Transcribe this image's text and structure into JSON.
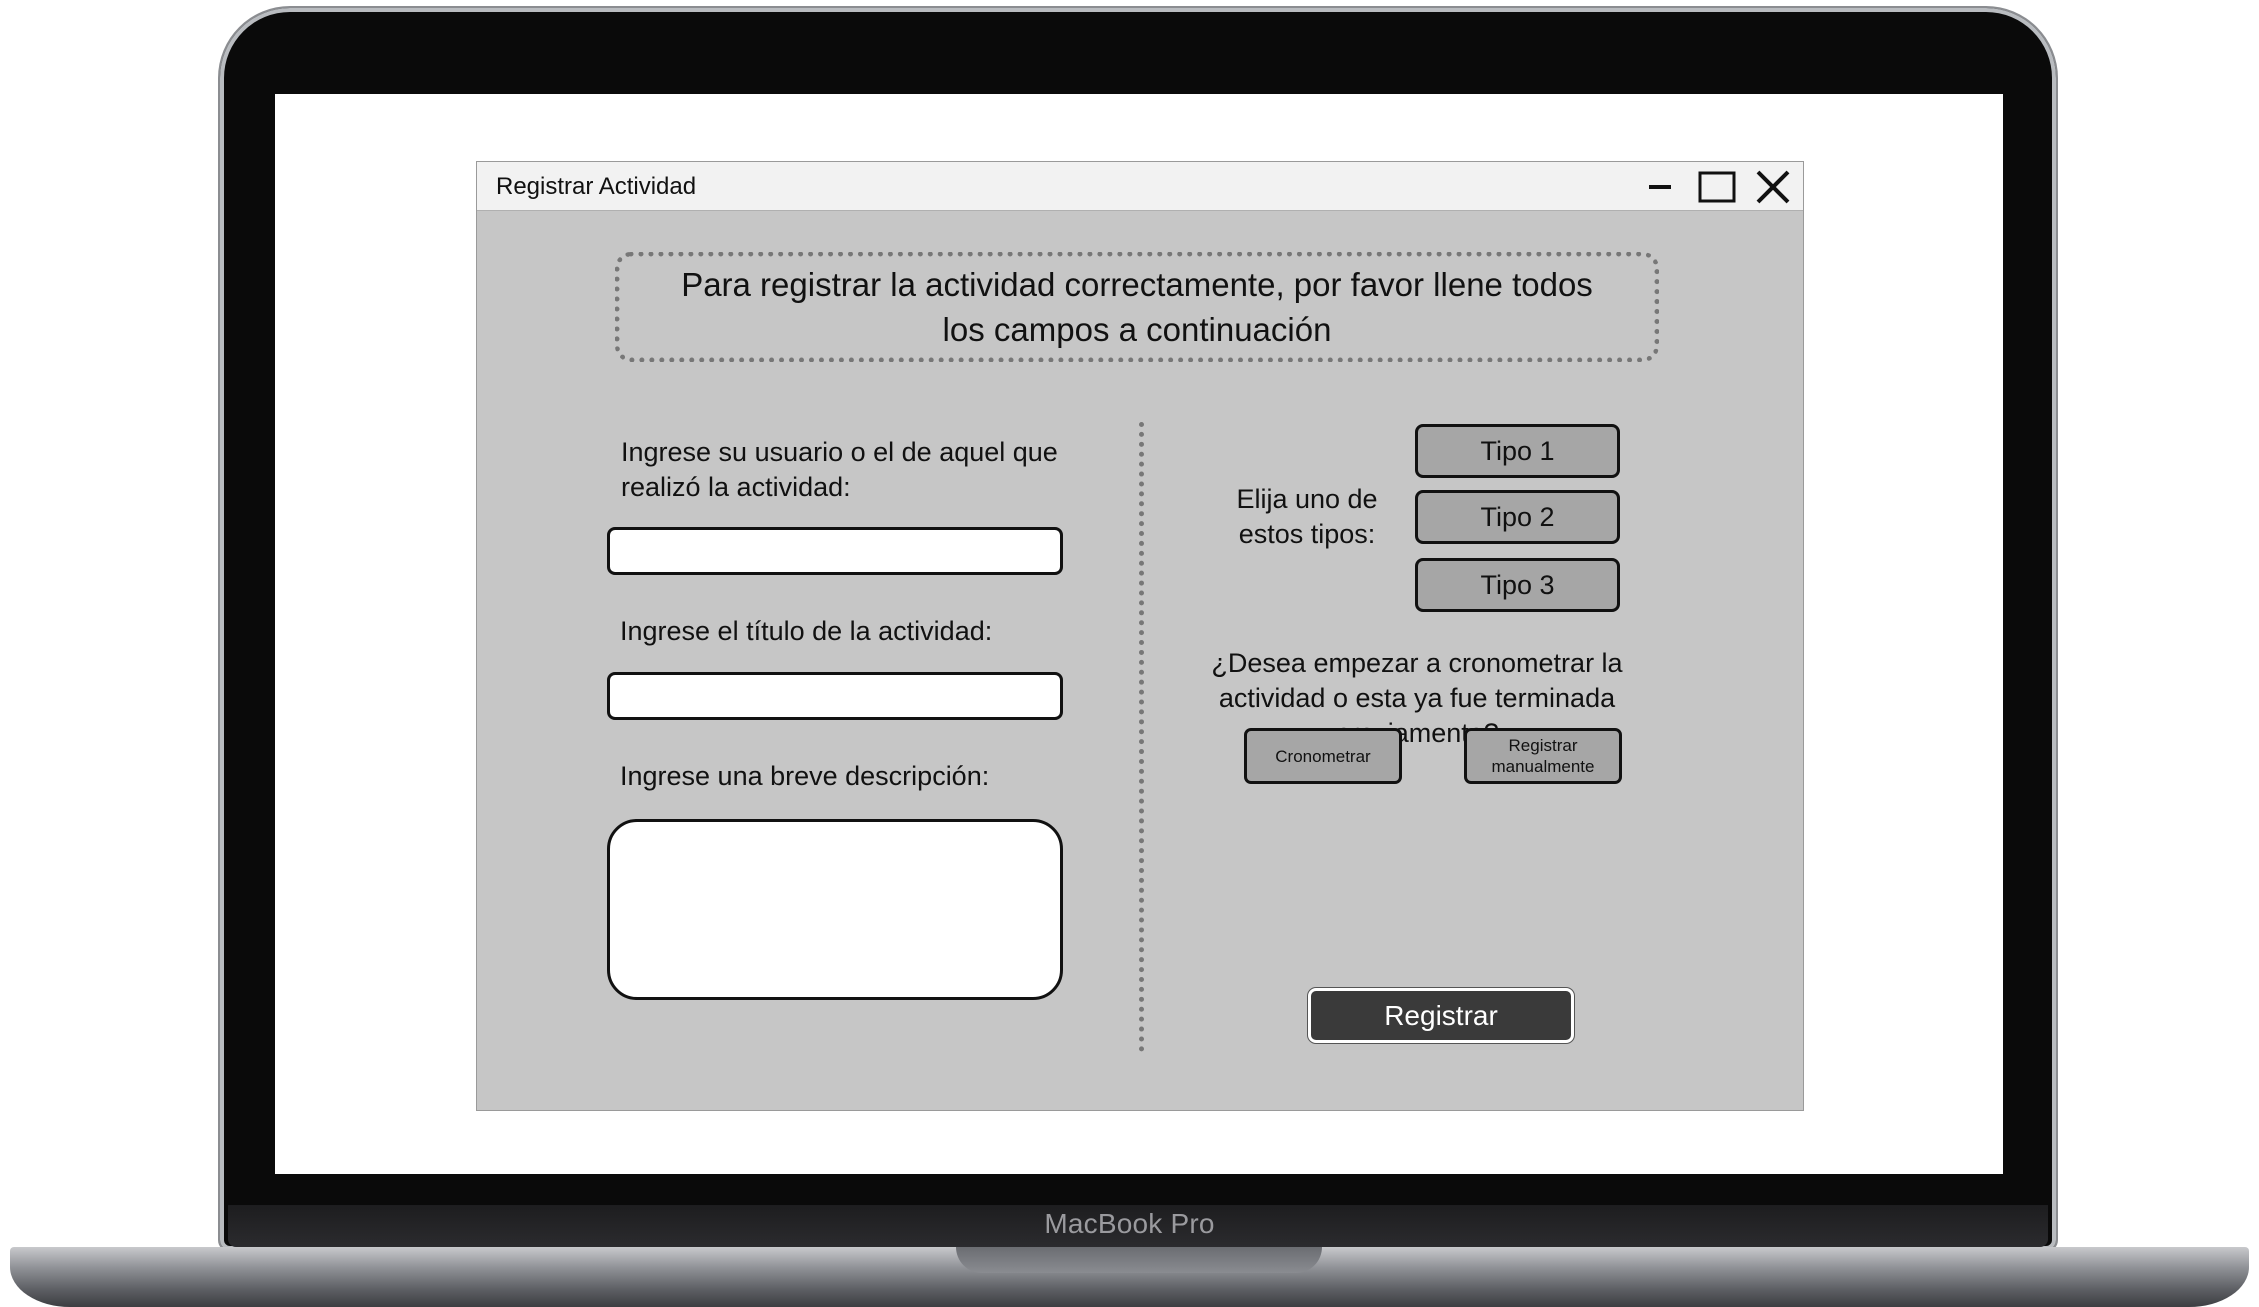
{
  "device": {
    "brand_label": "MacBook Pro"
  },
  "window": {
    "title": "Registrar Actividad",
    "controls": [
      "minimize-icon",
      "maximize-icon",
      "close-icon"
    ]
  },
  "form": {
    "banner": "Para registrar la actividad correctamente, por favor llene todos los campos a continuación",
    "user_label": "Ingrese su usuario o el de aquel que realizó la actividad:",
    "user_value": "",
    "title_label": "Ingrese el título de la actividad:",
    "title_value": "",
    "description_label": "Ingrese una breve descripción:",
    "description_value": ""
  },
  "types": {
    "label": "Elija uno de estos tipos:",
    "options": [
      "Tipo 1",
      "Tipo 2",
      "Tipo 3"
    ]
  },
  "timing": {
    "question": "¿Desea empezar a cronometrar la actividad o esta ya fue terminada previamente?",
    "start_timer_label": "Cronometrar",
    "manual_label": "Registrar manualmente"
  },
  "submit_label": "Registrar",
  "colors": {
    "window_bg": "#c6c6c6",
    "titlebar_bg": "#f2f2f2",
    "option_button_bg": "#a6a6a6",
    "submit_bg": "#3a3a3a"
  }
}
